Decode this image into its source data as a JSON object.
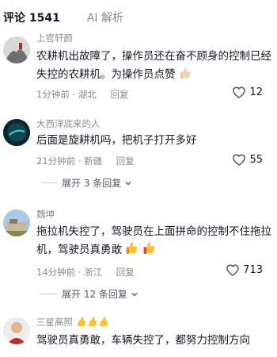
{
  "tabs": [
    {
      "label": "评论 1541"
    },
    {
      "label": "AI 解析"
    }
  ],
  "comments": [
    {
      "username": "上官轩颜",
      "text": "农耕机出故障了，操作员还在奋不顾身的控制已经失控的农耕机。为操作员点赞",
      "emojis": [
        "thumbs-up-icon"
      ],
      "time": "1分钟前 · 湖北",
      "reply_label": "回复",
      "likes": "12"
    },
    {
      "username": "大西洋底来的人",
      "text": "后面是旋耕机吗，把机子打开多好",
      "emojis": [],
      "time": "21分钟前 · 新疆",
      "reply_label": "回复",
      "likes": "55",
      "expand_label": "展开 3 条回复"
    },
    {
      "username": "魏坤",
      "text": "拖拉机失控了，驾驶员在上面拼命的控制不住拖拉机，驾驶员真勇敢",
      "emojis": [
        "thumbs-up-icon",
        "thumbs-up-icon"
      ],
      "time": "14分钟前 · 浙江",
      "reply_label": "回复",
      "likes": "713",
      "expand_label": "展开 12 条回复"
    },
    {
      "username": "三星高照",
      "username_emojis": [
        "flexed-biceps-icon",
        "flexed-biceps-icon",
        "flexed-biceps-icon"
      ],
      "text": "驾驶员真勇敢，车辆失控了，都努力控制方向"
    }
  ]
}
